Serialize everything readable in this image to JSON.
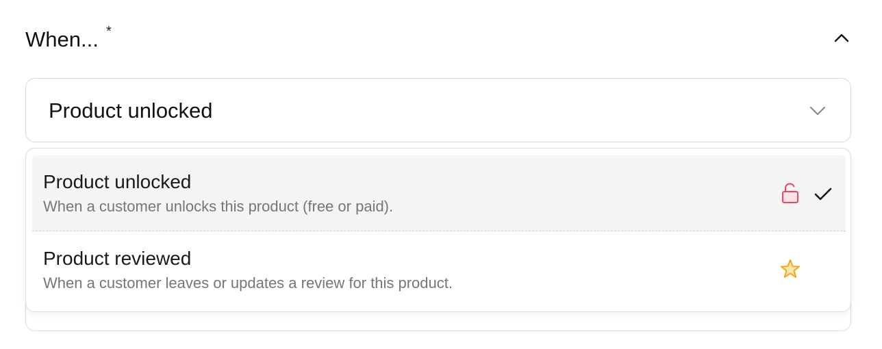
{
  "header": {
    "title": "When...",
    "required_marker": "*"
  },
  "select": {
    "value": "Product unlocked"
  },
  "options": [
    {
      "title": "Product unlocked",
      "description": "When a customer unlocks this product (free or paid).",
      "icon": "unlock-icon",
      "icon_color": "#e8455c",
      "selected": true
    },
    {
      "title": "Product reviewed",
      "description": "When a customer leaves or updates a review for this product.",
      "icon": "star-icon",
      "icon_color": "#f0a71e",
      "selected": false
    }
  ],
  "colors": {
    "selected_bg": "#f4f4f4",
    "border": "#d8d8d8",
    "secondary_text": "#767676"
  }
}
